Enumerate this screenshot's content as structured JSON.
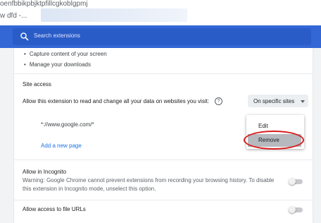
{
  "browser": {
    "url_fragment": "oenfbbikpbjktpfillcgkoblgpmj",
    "tab_fragment": "w dfd -..."
  },
  "search": {
    "placeholder": "Search extensions"
  },
  "permissions": {
    "items": [
      "Capture content of your screen",
      "Manage your downloads"
    ]
  },
  "site_access": {
    "title": "Site access",
    "prompt": "Allow this extension to read and change all your data on websites you visit:",
    "help_icon": "?",
    "dropdown_value": "On specific sites",
    "site": "*://www.google.com/*",
    "add_link": "Add a new page",
    "menu": {
      "edit_label": "Edit",
      "remove_label": "Remove"
    }
  },
  "incognito": {
    "title": "Allow in Incognito",
    "warning_line1": "Warning: Google Chrome cannot prevent extensions from recording your browsing history. To disable",
    "warning_line2": "this extension in Incognito mode, unselect this option.",
    "enabled": false
  },
  "file_urls": {
    "title": "Allow access to file URLs",
    "enabled": false
  },
  "colors": {
    "header_blue": "#3367d6",
    "link_blue": "#1a73e8",
    "annotation_red": "#d81b1b"
  },
  "icons": [
    "search-icon",
    "help-icon",
    "more-vert-icon"
  ]
}
